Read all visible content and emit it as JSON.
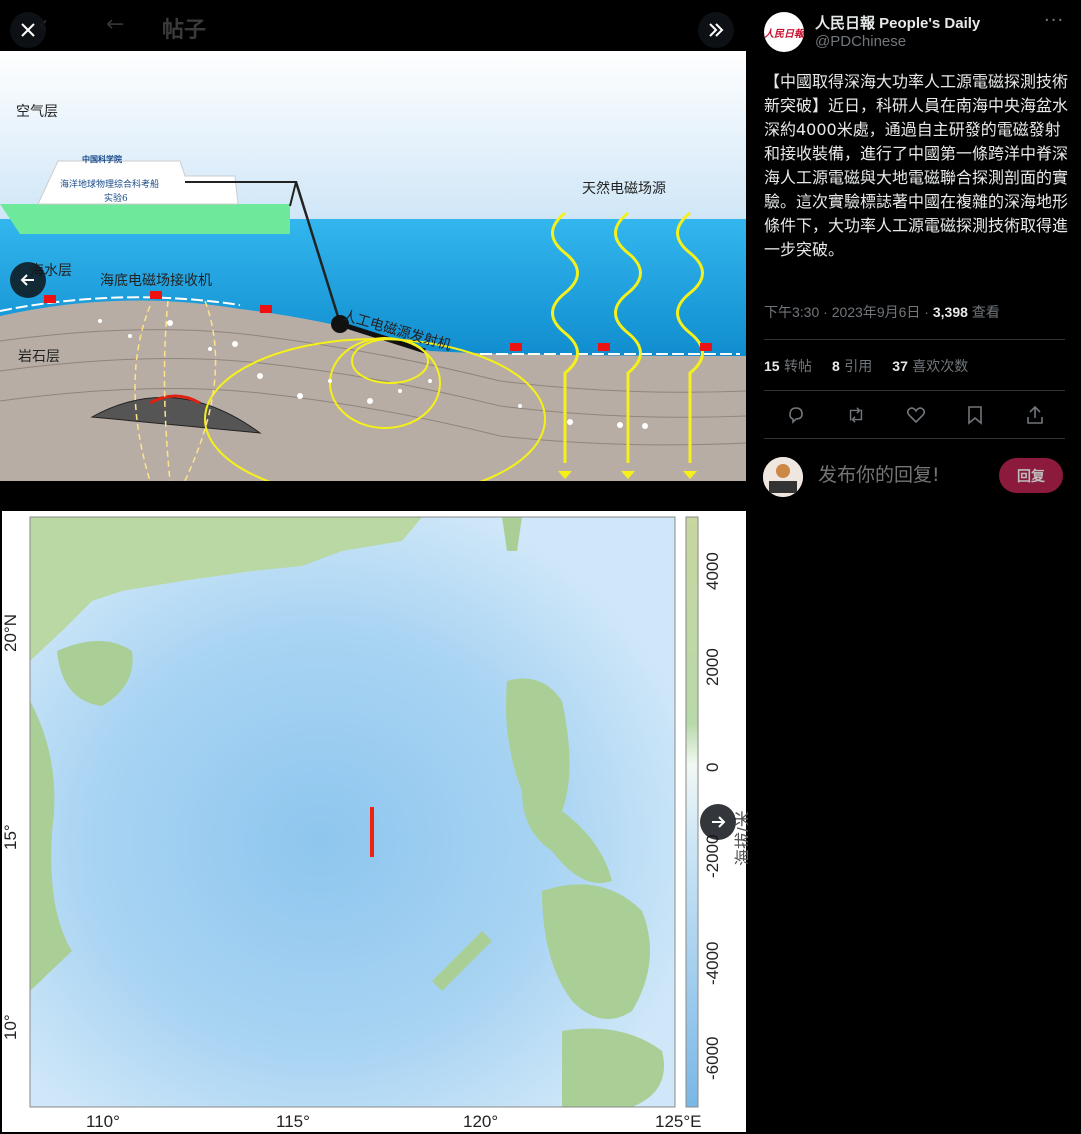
{
  "viewer": {
    "ghost_title": "帖子",
    "diagram": {
      "air_layer": "空气层",
      "water_layer": "海水层",
      "rock_layer": "岩石层",
      "receiver_label": "海底电磁场接收机",
      "natural_source_label": "天然电磁场源",
      "artificial_source_label": "人工电磁源发射机",
      "ship_label_line1": "海洋地球物理综合科考船",
      "ship_label_line2": "实验6",
      "ship_logo": "中国科学院"
    },
    "map": {
      "lon_labels": [
        "110°",
        "115°",
        "120°",
        "125°E"
      ],
      "lat_labels": [
        "20°N",
        "15°",
        "10°"
      ],
      "colorbar_labels": [
        "4000",
        "2000",
        "0",
        "-2000",
        "-4000",
        "-6000"
      ],
      "colorbar_title": "海拔/米"
    }
  },
  "post": {
    "author_name": "人民日報 People's Daily",
    "author_handle": "@PDChinese",
    "avatar_text": "人民日報",
    "text": "【中國取得深海大功率人工源電磁探測技術新突破】近日，科研人員在南海中央海盆水深約4000米處，通過自主研發的電磁發射和接收裝備，進行了中國第一條跨洋中脊深海人工源電磁與大地電磁聯合探測剖面的實驗。這次實驗標誌著中國在複雜的深海地形條件下，大功率人工源電磁探測技術取得進一步突破。",
    "time": "下午3:30 · 2023年9月6日 · ",
    "views": "3,398",
    "views_label": " 查看",
    "retweets": "15",
    "retweets_label": " 转帖",
    "quotes": "8",
    "quotes_label": " 引用",
    "likes": "37",
    "likes_label": " 喜欢次数"
  },
  "reply": {
    "placeholder": "发布你的回复!",
    "button_label": "回复"
  },
  "colors": {
    "reply_button": "#8b1a3d",
    "muted_text": "#71767b",
    "divider": "#2f3336"
  }
}
